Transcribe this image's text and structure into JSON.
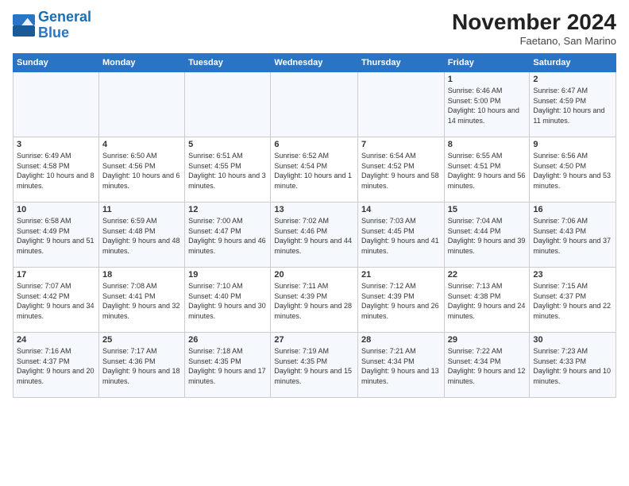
{
  "logo": {
    "line1": "General",
    "line2": "Blue"
  },
  "title": "November 2024",
  "subtitle": "Faetano, San Marino",
  "days_of_week": [
    "Sunday",
    "Monday",
    "Tuesday",
    "Wednesday",
    "Thursday",
    "Friday",
    "Saturday"
  ],
  "weeks": [
    [
      {
        "day": "",
        "content": ""
      },
      {
        "day": "",
        "content": ""
      },
      {
        "day": "",
        "content": ""
      },
      {
        "day": "",
        "content": ""
      },
      {
        "day": "",
        "content": ""
      },
      {
        "day": "1",
        "content": "Sunrise: 6:46 AM\nSunset: 5:00 PM\nDaylight: 10 hours and 14 minutes."
      },
      {
        "day": "2",
        "content": "Sunrise: 6:47 AM\nSunset: 4:59 PM\nDaylight: 10 hours and 11 minutes."
      }
    ],
    [
      {
        "day": "3",
        "content": "Sunrise: 6:49 AM\nSunset: 4:58 PM\nDaylight: 10 hours and 8 minutes."
      },
      {
        "day": "4",
        "content": "Sunrise: 6:50 AM\nSunset: 4:56 PM\nDaylight: 10 hours and 6 minutes."
      },
      {
        "day": "5",
        "content": "Sunrise: 6:51 AM\nSunset: 4:55 PM\nDaylight: 10 hours and 3 minutes."
      },
      {
        "day": "6",
        "content": "Sunrise: 6:52 AM\nSunset: 4:54 PM\nDaylight: 10 hours and 1 minute."
      },
      {
        "day": "7",
        "content": "Sunrise: 6:54 AM\nSunset: 4:52 PM\nDaylight: 9 hours and 58 minutes."
      },
      {
        "day": "8",
        "content": "Sunrise: 6:55 AM\nSunset: 4:51 PM\nDaylight: 9 hours and 56 minutes."
      },
      {
        "day": "9",
        "content": "Sunrise: 6:56 AM\nSunset: 4:50 PM\nDaylight: 9 hours and 53 minutes."
      }
    ],
    [
      {
        "day": "10",
        "content": "Sunrise: 6:58 AM\nSunset: 4:49 PM\nDaylight: 9 hours and 51 minutes."
      },
      {
        "day": "11",
        "content": "Sunrise: 6:59 AM\nSunset: 4:48 PM\nDaylight: 9 hours and 48 minutes."
      },
      {
        "day": "12",
        "content": "Sunrise: 7:00 AM\nSunset: 4:47 PM\nDaylight: 9 hours and 46 minutes."
      },
      {
        "day": "13",
        "content": "Sunrise: 7:02 AM\nSunset: 4:46 PM\nDaylight: 9 hours and 44 minutes."
      },
      {
        "day": "14",
        "content": "Sunrise: 7:03 AM\nSunset: 4:45 PM\nDaylight: 9 hours and 41 minutes."
      },
      {
        "day": "15",
        "content": "Sunrise: 7:04 AM\nSunset: 4:44 PM\nDaylight: 9 hours and 39 minutes."
      },
      {
        "day": "16",
        "content": "Sunrise: 7:06 AM\nSunset: 4:43 PM\nDaylight: 9 hours and 37 minutes."
      }
    ],
    [
      {
        "day": "17",
        "content": "Sunrise: 7:07 AM\nSunset: 4:42 PM\nDaylight: 9 hours and 34 minutes."
      },
      {
        "day": "18",
        "content": "Sunrise: 7:08 AM\nSunset: 4:41 PM\nDaylight: 9 hours and 32 minutes."
      },
      {
        "day": "19",
        "content": "Sunrise: 7:10 AM\nSunset: 4:40 PM\nDaylight: 9 hours and 30 minutes."
      },
      {
        "day": "20",
        "content": "Sunrise: 7:11 AM\nSunset: 4:39 PM\nDaylight: 9 hours and 28 minutes."
      },
      {
        "day": "21",
        "content": "Sunrise: 7:12 AM\nSunset: 4:39 PM\nDaylight: 9 hours and 26 minutes."
      },
      {
        "day": "22",
        "content": "Sunrise: 7:13 AM\nSunset: 4:38 PM\nDaylight: 9 hours and 24 minutes."
      },
      {
        "day": "23",
        "content": "Sunrise: 7:15 AM\nSunset: 4:37 PM\nDaylight: 9 hours and 22 minutes."
      }
    ],
    [
      {
        "day": "24",
        "content": "Sunrise: 7:16 AM\nSunset: 4:37 PM\nDaylight: 9 hours and 20 minutes."
      },
      {
        "day": "25",
        "content": "Sunrise: 7:17 AM\nSunset: 4:36 PM\nDaylight: 9 hours and 18 minutes."
      },
      {
        "day": "26",
        "content": "Sunrise: 7:18 AM\nSunset: 4:35 PM\nDaylight: 9 hours and 17 minutes."
      },
      {
        "day": "27",
        "content": "Sunrise: 7:19 AM\nSunset: 4:35 PM\nDaylight: 9 hours and 15 minutes."
      },
      {
        "day": "28",
        "content": "Sunrise: 7:21 AM\nSunset: 4:34 PM\nDaylight: 9 hours and 13 minutes."
      },
      {
        "day": "29",
        "content": "Sunrise: 7:22 AM\nSunset: 4:34 PM\nDaylight: 9 hours and 12 minutes."
      },
      {
        "day": "30",
        "content": "Sunrise: 7:23 AM\nSunset: 4:33 PM\nDaylight: 9 hours and 10 minutes."
      }
    ]
  ]
}
